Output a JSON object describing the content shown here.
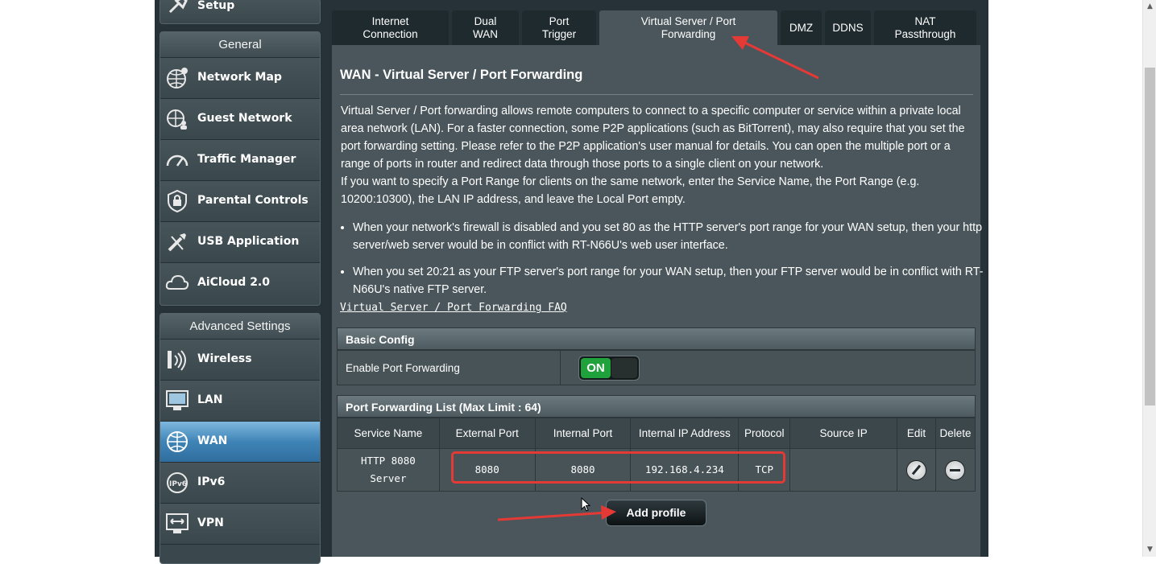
{
  "sidebar": {
    "top_item": {
      "label": "Setup",
      "icon": "setup-icon"
    },
    "general": {
      "header": "General",
      "items": [
        {
          "label": "Network Map",
          "icon": "globe-network-icon"
        },
        {
          "label": "Guest Network",
          "icon": "guest-network-icon"
        },
        {
          "label": "Traffic Manager",
          "icon": "speedometer-icon"
        },
        {
          "label": "Parental Controls",
          "icon": "lock-shield-icon"
        },
        {
          "label": "USB Application",
          "icon": "usb-tools-icon"
        },
        {
          "label": "AiCloud 2.0",
          "icon": "cloud-icon"
        }
      ]
    },
    "advanced": {
      "header": "Advanced Settings",
      "items": [
        {
          "label": "Wireless",
          "icon": "wifi-icon"
        },
        {
          "label": "LAN",
          "icon": "monitor-icon"
        },
        {
          "label": "WAN",
          "icon": "globe-icon",
          "active": true
        },
        {
          "label": "IPv6",
          "icon": "ipv6-icon"
        },
        {
          "label": "VPN",
          "icon": "vpn-icon"
        }
      ]
    }
  },
  "tabs": [
    {
      "line1": "Internet",
      "line2": "Connection"
    },
    {
      "line1": "Dual",
      "line2": "WAN"
    },
    {
      "line1": "Port",
      "line2": "Trigger"
    },
    {
      "line1": "Virtual Server / Port",
      "line2": "Forwarding",
      "active": true
    },
    {
      "line1": "DMZ",
      "line2": ""
    },
    {
      "line1": "DDNS",
      "line2": ""
    },
    {
      "line1": "NAT",
      "line2": "Passthrough"
    }
  ],
  "page": {
    "title": "WAN - Virtual Server / Port Forwarding",
    "description1": "Virtual Server / Port forwarding allows remote computers to connect to a specific computer or service within a private local area network (LAN). For a faster connection, some P2P applications (such as BitTorrent), may also require that you set the port forwarding setting. Please refer to the P2P application's user manual for details. You can open the multiple port or a range of ports in router and redirect data through those ports to a single client on your network.",
    "description2": "If you want to specify a Port Range for clients on the same network, enter the Service Name, the Port Range (e.g. 10200:10300), the LAN IP address, and leave the Local Port empty.",
    "bullets": [
      "When your network's firewall is disabled and you set 80 as the HTTP server's port range for your WAN setup, then your http server/web server would be in conflict with RT-N66U's web user interface.",
      "When you set 20:21 as your FTP server's port range for your WAN setup, then your FTP server would be in conflict with RT-N66U's native FTP server."
    ],
    "faq_link": "Virtual Server / Port Forwarding FAQ"
  },
  "basic_config": {
    "header": "Basic Config",
    "enable_label": "Enable Port Forwarding",
    "toggle_on": "ON"
  },
  "pf_list": {
    "header": "Port Forwarding List (Max Limit : 64)",
    "columns": [
      "Service Name",
      "External Port",
      "Internal Port",
      "Internal IP Address",
      "Protocol",
      "Source IP",
      "Edit",
      "Delete"
    ],
    "rows": [
      {
        "service_line1": "HTTP 8080",
        "service_line2": "Server",
        "external_port": "8080",
        "internal_port": "8080",
        "internal_ip": "192.168.4.234",
        "protocol": "TCP",
        "source_ip": ""
      }
    ]
  },
  "add_profile": "Add profile",
  "colors": {
    "highlight": "#e53935",
    "active_menu": "#3f84b6",
    "toggle_on": "#1fa13b"
  }
}
